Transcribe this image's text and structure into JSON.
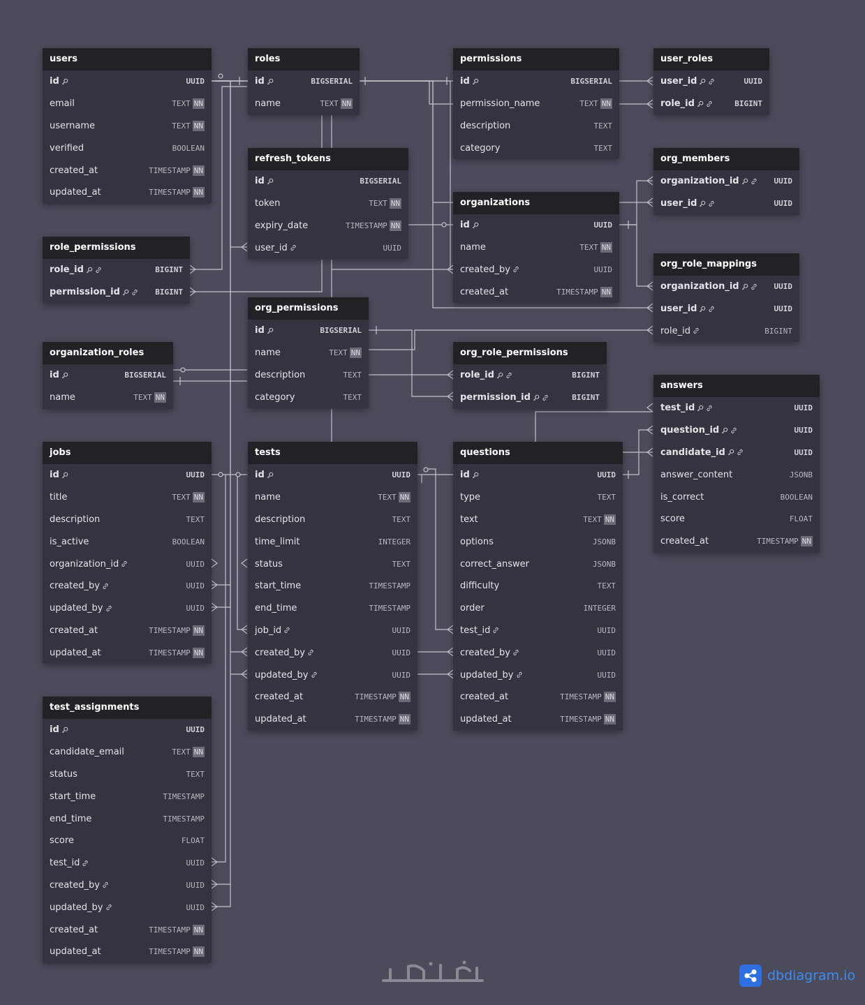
{
  "tables": [
    {
      "key": "users",
      "name": "users",
      "fields": [
        {
          "name": "id",
          "type": "UUID",
          "pk": true
        },
        {
          "name": "email",
          "type": "TEXT",
          "nn": true
        },
        {
          "name": "username",
          "type": "TEXT",
          "nn": true
        },
        {
          "name": "verified",
          "type": "BOOLEAN"
        },
        {
          "name": "created_at",
          "type": "TIMESTAMP",
          "nn": true
        },
        {
          "name": "updated_at",
          "type": "TIMESTAMP",
          "nn": true
        }
      ]
    },
    {
      "key": "roles",
      "name": "roles",
      "fields": [
        {
          "name": "id",
          "type": "BIGSERIAL",
          "pk": true
        },
        {
          "name": "name",
          "type": "TEXT",
          "nn": true
        }
      ]
    },
    {
      "key": "permissions",
      "name": "permissions",
      "fields": [
        {
          "name": "id",
          "type": "BIGSERIAL",
          "pk": true
        },
        {
          "name": "permission_name",
          "type": "TEXT",
          "nn": true
        },
        {
          "name": "description",
          "type": "TEXT"
        },
        {
          "name": "category",
          "type": "TEXT"
        }
      ]
    },
    {
      "key": "user_roles",
      "name": "user_roles",
      "fields": [
        {
          "name": "user_id",
          "type": "UUID",
          "pk": true,
          "fk": true
        },
        {
          "name": "role_id",
          "type": "BIGINT",
          "pk": true,
          "fk": true
        }
      ]
    },
    {
      "key": "refresh_tokens",
      "name": "refresh_tokens",
      "fields": [
        {
          "name": "id",
          "type": "BIGSERIAL",
          "pk": true
        },
        {
          "name": "token",
          "type": "TEXT",
          "nn": true
        },
        {
          "name": "expiry_date",
          "type": "TIMESTAMP",
          "nn": true
        },
        {
          "name": "user_id",
          "type": "UUID",
          "fk": true
        }
      ]
    },
    {
      "key": "org_members",
      "name": "org_members",
      "fields": [
        {
          "name": "organization_id",
          "type": "UUID",
          "pk": true,
          "fk": true
        },
        {
          "name": "user_id",
          "type": "UUID",
          "pk": true,
          "fk": true
        }
      ]
    },
    {
      "key": "organizations",
      "name": "organizations",
      "fields": [
        {
          "name": "id",
          "type": "UUID",
          "pk": true
        },
        {
          "name": "name",
          "type": "TEXT",
          "nn": true
        },
        {
          "name": "created_by",
          "type": "UUID",
          "fk": true
        },
        {
          "name": "created_at",
          "type": "TIMESTAMP",
          "nn": true
        }
      ]
    },
    {
      "key": "role_permissions",
      "name": "role_permissions",
      "fields": [
        {
          "name": "role_id",
          "type": "BIGINT",
          "pk": true,
          "fk": true
        },
        {
          "name": "permission_id",
          "type": "BIGINT",
          "pk": true,
          "fk": true
        }
      ]
    },
    {
      "key": "org_role_mappings",
      "name": "org_role_mappings",
      "fields": [
        {
          "name": "organization_id",
          "type": "UUID",
          "pk": true,
          "fk": true
        },
        {
          "name": "user_id",
          "type": "UUID",
          "pk": true,
          "fk": true
        },
        {
          "name": "role_id",
          "type": "BIGINT",
          "fk": true
        }
      ]
    },
    {
      "key": "org_permissions",
      "name": "org_permissions",
      "fields": [
        {
          "name": "id",
          "type": "BIGSERIAL",
          "pk": true
        },
        {
          "name": "name",
          "type": "TEXT",
          "nn": true
        },
        {
          "name": "description",
          "type": "TEXT"
        },
        {
          "name": "category",
          "type": "TEXT"
        }
      ]
    },
    {
      "key": "organization_roles",
      "name": "organization_roles",
      "fields": [
        {
          "name": "id",
          "type": "BIGSERIAL",
          "pk": true
        },
        {
          "name": "name",
          "type": "TEXT",
          "nn": true
        }
      ]
    },
    {
      "key": "org_role_permissions",
      "name": "org_role_permissions",
      "fields": [
        {
          "name": "role_id",
          "type": "BIGINT",
          "pk": true,
          "fk": true
        },
        {
          "name": "permission_id",
          "type": "BIGINT",
          "pk": true,
          "fk": true
        }
      ]
    },
    {
      "key": "answers",
      "name": "answers",
      "fields": [
        {
          "name": "test_id",
          "type": "UUID",
          "pk": true,
          "fk": true
        },
        {
          "name": "question_id",
          "type": "UUID",
          "pk": true,
          "fk": true
        },
        {
          "name": "candidate_id",
          "type": "UUID",
          "pk": true,
          "fk": true
        },
        {
          "name": "answer_content",
          "type": "JSONB"
        },
        {
          "name": "is_correct",
          "type": "BOOLEAN"
        },
        {
          "name": "score",
          "type": "FLOAT"
        },
        {
          "name": "created_at",
          "type": "TIMESTAMP",
          "nn": true
        }
      ]
    },
    {
      "key": "jobs",
      "name": "jobs",
      "fields": [
        {
          "name": "id",
          "type": "UUID",
          "pk": true
        },
        {
          "name": "title",
          "type": "TEXT",
          "nn": true
        },
        {
          "name": "description",
          "type": "TEXT"
        },
        {
          "name": "is_active",
          "type": "BOOLEAN"
        },
        {
          "name": "organization_id",
          "type": "UUID",
          "fk": true
        },
        {
          "name": "created_by",
          "type": "UUID",
          "fk": true
        },
        {
          "name": "updated_by",
          "type": "UUID",
          "fk": true
        },
        {
          "name": "created_at",
          "type": "TIMESTAMP",
          "nn": true
        },
        {
          "name": "updated_at",
          "type": "TIMESTAMP",
          "nn": true
        }
      ]
    },
    {
      "key": "tests",
      "name": "tests",
      "fields": [
        {
          "name": "id",
          "type": "UUID",
          "pk": true
        },
        {
          "name": "name",
          "type": "TEXT",
          "nn": true
        },
        {
          "name": "description",
          "type": "TEXT"
        },
        {
          "name": "time_limit",
          "type": "INTEGER"
        },
        {
          "name": "status",
          "type": "TEXT"
        },
        {
          "name": "start_time",
          "type": "TIMESTAMP"
        },
        {
          "name": "end_time",
          "type": "TIMESTAMP"
        },
        {
          "name": "job_id",
          "type": "UUID",
          "fk": true
        },
        {
          "name": "created_by",
          "type": "UUID",
          "fk": true
        },
        {
          "name": "updated_by",
          "type": "UUID",
          "fk": true
        },
        {
          "name": "created_at",
          "type": "TIMESTAMP",
          "nn": true
        },
        {
          "name": "updated_at",
          "type": "TIMESTAMP",
          "nn": true
        }
      ]
    },
    {
      "key": "questions",
      "name": "questions",
      "fields": [
        {
          "name": "id",
          "type": "UUID",
          "pk": true
        },
        {
          "name": "type",
          "type": "TEXT"
        },
        {
          "name": "text",
          "type": "TEXT",
          "nn": true
        },
        {
          "name": "options",
          "type": "JSONB"
        },
        {
          "name": "correct_answer",
          "type": "JSONB"
        },
        {
          "name": "difficulty",
          "type": "TEXT"
        },
        {
          "name": "order",
          "type": "INTEGER"
        },
        {
          "name": "test_id",
          "type": "UUID",
          "fk": true
        },
        {
          "name": "created_by",
          "type": "UUID",
          "fk": true
        },
        {
          "name": "updated_by",
          "type": "UUID",
          "fk": true
        },
        {
          "name": "created_at",
          "type": "TIMESTAMP",
          "nn": true
        },
        {
          "name": "updated_at",
          "type": "TIMESTAMP",
          "nn": true
        }
      ]
    },
    {
      "key": "test_assignments",
      "name": "test_assignments",
      "fields": [
        {
          "name": "id",
          "type": "UUID",
          "pk": true
        },
        {
          "name": "candidate_email",
          "type": "TEXT",
          "nn": true
        },
        {
          "name": "status",
          "type": "TEXT"
        },
        {
          "name": "start_time",
          "type": "TIMESTAMP"
        },
        {
          "name": "end_time",
          "type": "TIMESTAMP"
        },
        {
          "name": "score",
          "type": "FLOAT"
        },
        {
          "name": "test_id",
          "type": "UUID",
          "fk": true
        },
        {
          "name": "created_by",
          "type": "UUID",
          "fk": true
        },
        {
          "name": "updated_by",
          "type": "UUID",
          "fk": true
        },
        {
          "name": "created_at",
          "type": "TIMESTAMP",
          "nn": true
        },
        {
          "name": "updated_at",
          "type": "TIMESTAMP",
          "nn": true
        }
      ]
    }
  ],
  "labels": {
    "not_null": "NN"
  },
  "brand": {
    "name": "dbdiagram.io",
    "color": "#3f8cf0",
    "logo_icon": "share-nodes-icon"
  },
  "watermark": {
    "icon": "khamsat-logo-watermark"
  },
  "colors": {
    "background": "#4b4b5b",
    "table_body": "#343440",
    "table_header": "#222226",
    "connector": "#c4c4cc"
  }
}
